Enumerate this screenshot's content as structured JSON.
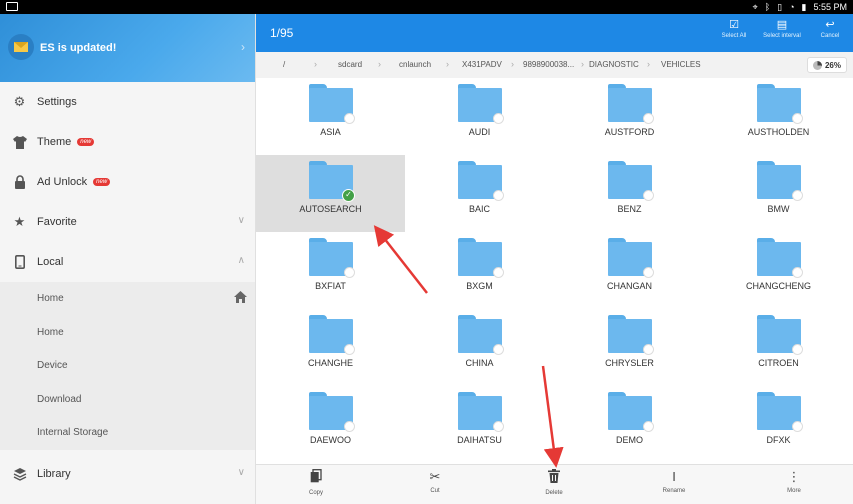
{
  "status_bar": {
    "time": "5:55 PM"
  },
  "sidebar": {
    "header_title": "ES is updated!",
    "items": [
      {
        "label": "Settings",
        "icon": "gear-icon"
      },
      {
        "label": "Theme",
        "icon": "shirt-icon",
        "badge": "new"
      },
      {
        "label": "Ad Unlock",
        "icon": "lock-icon",
        "badge": "new"
      },
      {
        "label": "Favorite",
        "icon": "star-icon"
      },
      {
        "label": "Local",
        "icon": "phone-icon"
      }
    ],
    "local_items": [
      "Home",
      "Home",
      "Device",
      "Download",
      "Internal Storage"
    ],
    "library_label": "Library"
  },
  "topbar": {
    "count": "1/95",
    "select_all": "Select All",
    "select_interval": "Select interval",
    "cancel": "Cancel"
  },
  "breadcrumb": {
    "items": [
      "/",
      "sdcard",
      "cnlaunch",
      "X431PADV",
      "9898900038...",
      "DIAGNOSTIC",
      "VEHICLES"
    ],
    "storage": "26%"
  },
  "folders": [
    "ASIA",
    "AUDI",
    "AUSTFORD",
    "AUSTHOLDEN",
    "AUTOSEARCH",
    "BAIC",
    "BENZ",
    "BMW",
    "BXFIAT",
    "BXGM",
    "CHANGAN",
    "CHANGCHENG",
    "CHANGHE",
    "CHINA",
    "CHRYSLER",
    "CITROEN",
    "DAEWOO",
    "DAIHATSU",
    "DEMO",
    "DFXK"
  ],
  "toolbar": {
    "copy": "Copy",
    "cut": "Cut",
    "delete": "Delete",
    "rename": "Rename",
    "more": "More"
  },
  "colors": {
    "accent": "#1e88e5",
    "folder": "#6cb8ee",
    "arrow": "#e53935",
    "selected_check": "#43a047"
  }
}
